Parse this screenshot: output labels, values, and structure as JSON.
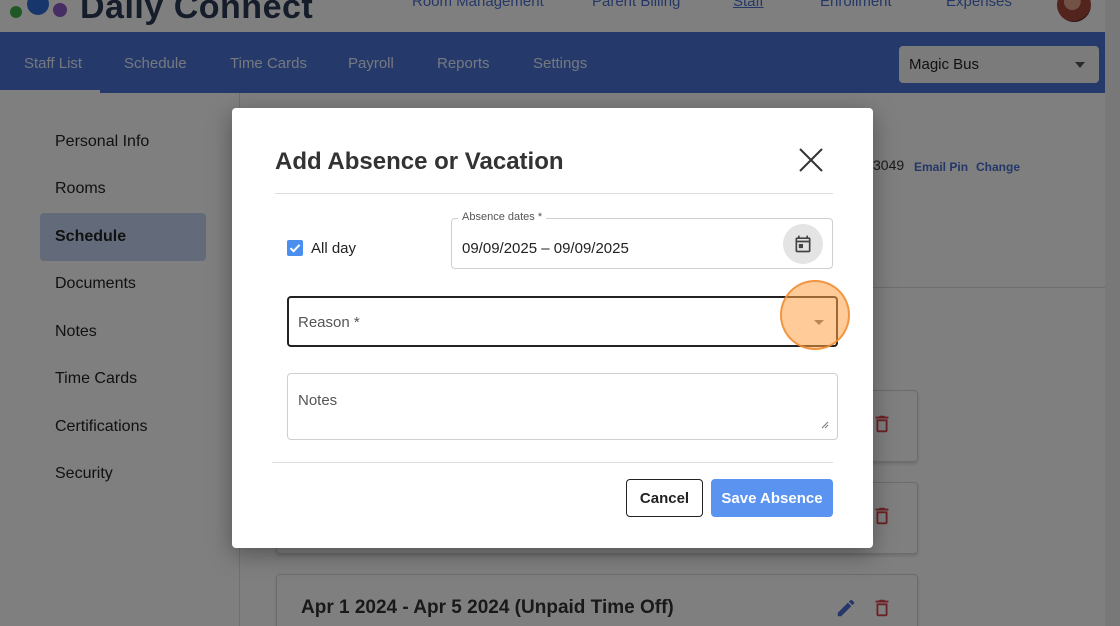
{
  "app": {
    "name": "Daily Connect"
  },
  "top_nav": [
    "Room Management",
    "Parent Billing",
    "Staff",
    "Enrollment",
    "Expenses"
  ],
  "nav_tabs": [
    "Staff List",
    "Schedule",
    "Time Cards",
    "Payroll",
    "Reports",
    "Settings"
  ],
  "org_select": {
    "value": "Magic Bus"
  },
  "sidebar": {
    "items": [
      "Personal Info",
      "Rooms",
      "Schedule",
      "Documents",
      "Notes",
      "Time Cards",
      "Certifications",
      "Security"
    ],
    "active": "Schedule"
  },
  "background": {
    "pin_fragment": "3049",
    "email_pin_link": "Email Pin",
    "change_link": "Change",
    "visible_card_title": "Apr 1 2024 - Apr 5 2024   (Unpaid Time Off)"
  },
  "modal": {
    "title": "Add Absence or Vacation",
    "all_day": {
      "label": "All day",
      "checked": true
    },
    "absence_dates": {
      "label": "Absence dates *",
      "value": "09/09/2025 – 09/09/2025"
    },
    "reason": {
      "placeholder": "Reason *",
      "value": ""
    },
    "notes": {
      "placeholder": "Notes",
      "value": ""
    },
    "cancel_label": "Cancel",
    "save_label": "Save Absence"
  },
  "colors": {
    "nav_blue": "#4a75d6",
    "link_blue": "#4a6fd0",
    "save_button": "#5b93f0",
    "sidebar_active": "#c6d6f6",
    "delete_red": "#d9434b",
    "click_highlight": "#ffa046"
  },
  "icons": [
    "close-icon",
    "calendar-icon",
    "chevron-down-icon",
    "check-icon",
    "pencil-icon",
    "trash-icon",
    "resize-handle-icon"
  ]
}
